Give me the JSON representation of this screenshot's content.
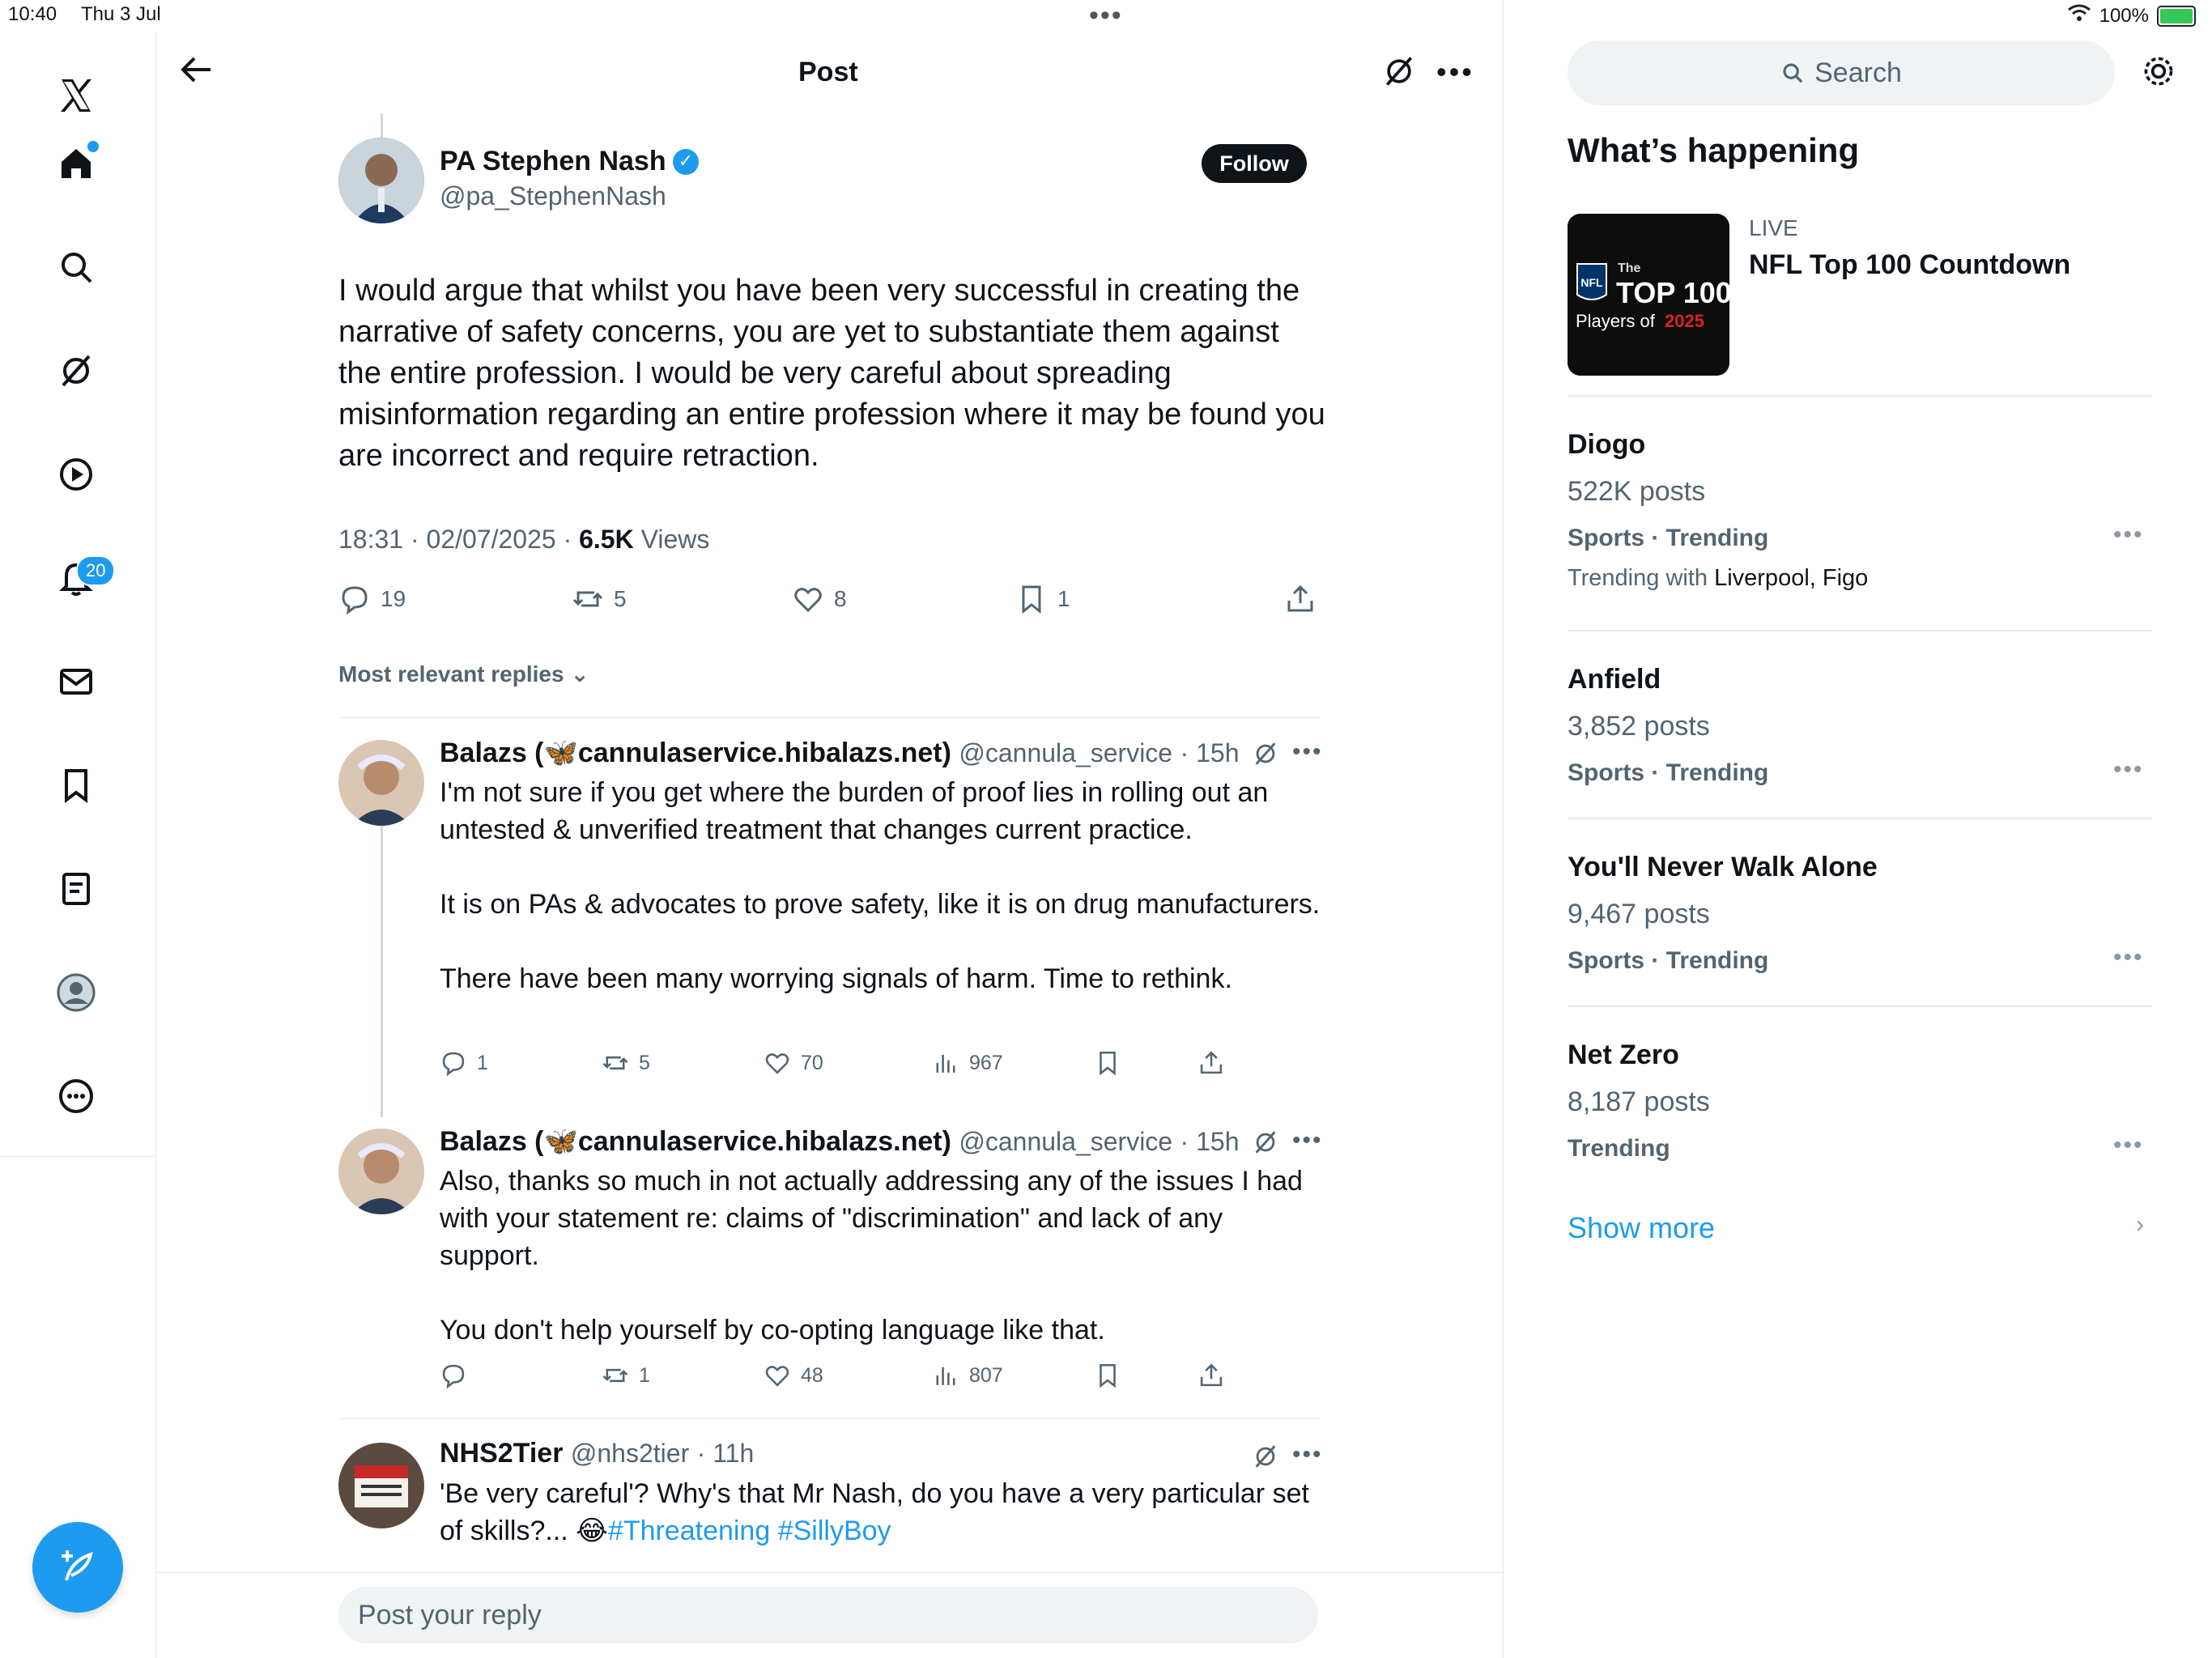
{
  "status_bar": {
    "time": "10:40",
    "date": "Thu 3 Jul",
    "battery": "100%"
  },
  "nav": {
    "notifications_badge": "20"
  },
  "header": {
    "title": "Post"
  },
  "post": {
    "name": "PA Stephen Nash",
    "handle": "@pa_StephenNash",
    "follow_label": "Follow",
    "text": "I would argue that whilst you have been very successful in creating the narrative of safety concerns, you are yet to substantiate them against the entire profession. I would be very careful about spreading misinformation regarding an entire profession where it may be found you are incorrect and require retraction.",
    "timestamp": "18:31 · 02/07/2025 · ",
    "views_count": "6.5K",
    "views_label": " Views",
    "replies": "19",
    "reposts": "5",
    "likes": "8",
    "bookmarks": "1"
  },
  "sort_label": "Most relevant replies",
  "replies": [
    {
      "name": "Balazs (🦋cannulaservice.hibalazs.net)",
      "handle": "@cannula_service",
      "time": "· 15h",
      "text": "I'm not sure if you get where the burden of proof lies in rolling out an untested & unverified treatment that changes current practice.\n\nIt is on PAs & advocates to prove safety, like it is on drug manufacturers.\n\nThere have been many worrying signals of harm. Time to rethink.",
      "replies": "1",
      "reposts": "5",
      "likes": "70",
      "views": "967"
    },
    {
      "name": "Balazs (🦋cannulaservice.hibalazs.net)",
      "handle": "@cannula_service",
      "time": "· 15h",
      "text": "Also, thanks so much in not actually addressing any of the issues I had with your statement re: claims of \"discrimination\" and lack of any support.\n\nYou don't help yourself by co-opting language like that.",
      "replies": "",
      "reposts": "1",
      "likes": "48",
      "views": "807"
    },
    {
      "name": "NHS2Tier",
      "handle": "@nhs2tier",
      "time": "· 11h",
      "text_start": "'Be very careful'? Why's that Mr Nash, do you have a very particular set of skills?... 😂",
      "hashtag1": "#Threatening",
      "hashtag2": "#SillyBoy"
    }
  ],
  "reply_bar": {
    "placeholder": "Post your reply"
  },
  "sidebar": {
    "search_label": "Search",
    "heading": "What’s happening",
    "live": {
      "label": "LIVE",
      "title": "NFL Top 100 Countdown",
      "img_line1": "The",
      "img_line2": "TOP 100",
      "img_line3": "Players of",
      "img_year": "2025",
      "img_nfl": "NFL"
    },
    "trends": [
      {
        "title": "Diogo",
        "count": "522K posts",
        "category": "Sports · Trending",
        "with_label": "Trending with ",
        "with_value": "Liverpool, Figo"
      },
      {
        "title": "Anfield",
        "count": "3,852 posts",
        "category": "Sports · Trending"
      },
      {
        "title": "You'll Never Walk Alone",
        "count": "9,467 posts",
        "category": "Sports · Trending"
      },
      {
        "title": "Net Zero",
        "count": "8,187 posts",
        "category": "Trending"
      }
    ],
    "show_more": "Show more"
  }
}
